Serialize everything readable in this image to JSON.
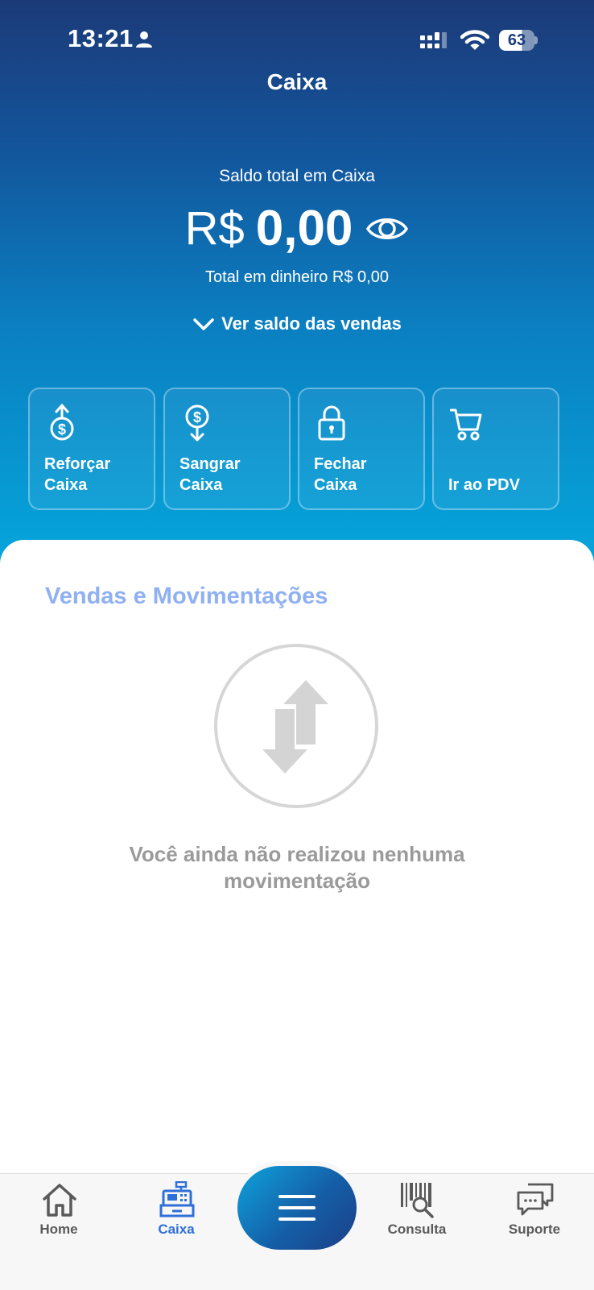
{
  "status_bar": {
    "time": "13:21",
    "battery": "63"
  },
  "header": {
    "title": "Caixa"
  },
  "balance": {
    "label": "Saldo total em Caixa",
    "currency": "R$",
    "amount": "0,00",
    "cash_total": "Total em dinheiro R$ 0,00",
    "toggle_label": "Ver saldo das vendas"
  },
  "actions": [
    {
      "label": "Reforçar\nCaixa",
      "icon": "dollar-up-icon"
    },
    {
      "label": "Sangrar\nCaixa",
      "icon": "dollar-down-icon"
    },
    {
      "label": "Fechar\nCaixa",
      "icon": "lock-icon"
    },
    {
      "label": "Ir ao PDV",
      "icon": "cart-icon"
    }
  ],
  "activity": {
    "title": "Vendas e Movimentações",
    "empty_message": "Você ainda não realizou nenhuma movimentação"
  },
  "bottom_nav": {
    "items": [
      {
        "label": "Home",
        "icon": "home-icon"
      },
      {
        "label": "Caixa",
        "icon": "cash-register-icon",
        "active": true
      },
      {
        "label": "Consulta",
        "icon": "barcode-search-icon"
      },
      {
        "label": "Suporte",
        "icon": "chat-icon"
      }
    ],
    "menu_icon": "menu-icon"
  },
  "colors": {
    "header_top": "#1c3a78",
    "header_bottom": "#05a8dd",
    "section_title": "#8fb0f2",
    "nav_active": "#2f6fd8"
  }
}
